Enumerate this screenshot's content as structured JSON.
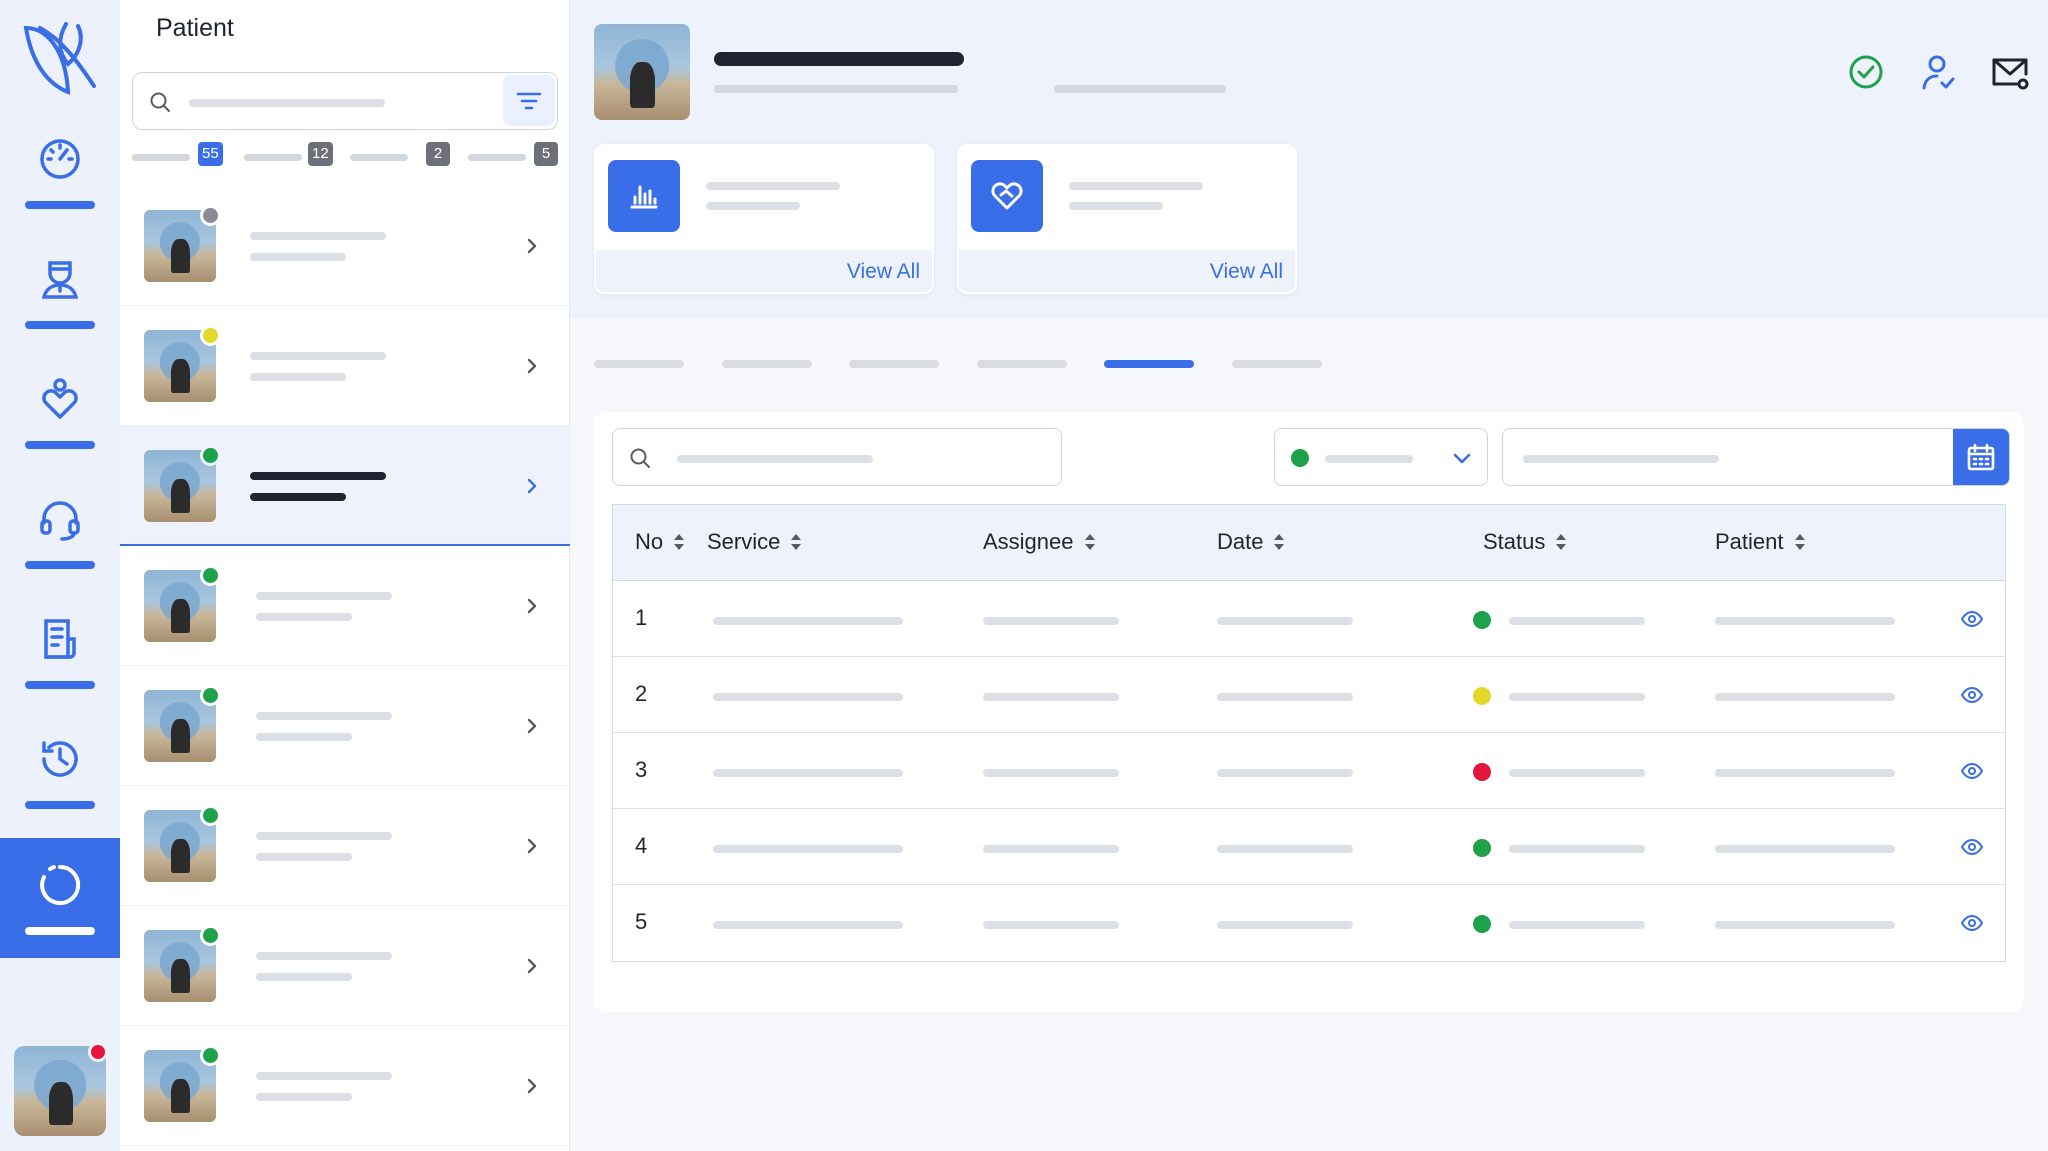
{
  "colors": {
    "accent": "#3a6ee8",
    "online": "#1ea149",
    "away": "#e3d92a",
    "busy": "#e5163b",
    "offline": "#8a8d93"
  },
  "sidebar": {
    "items": [
      {
        "icon": "dashboard-gauge-icon",
        "active": false
      },
      {
        "icon": "doctor-icon",
        "active": false
      },
      {
        "icon": "care-heart-icon",
        "active": false
      },
      {
        "icon": "headset-support-icon",
        "active": false
      },
      {
        "icon": "report-document-icon",
        "active": false
      },
      {
        "icon": "history-icon",
        "active": false
      },
      {
        "icon": "loading-spinner-icon",
        "active": true
      }
    ],
    "user_status_color": "#e5163b"
  },
  "patient_list": {
    "title": "Patient",
    "counts": [
      "55",
      "12",
      "2",
      "5"
    ],
    "patients": [
      {
        "status_color": "#8a8d93",
        "selected": false
      },
      {
        "status_color": "#e3d92a",
        "selected": false
      },
      {
        "status_color": "#1ea149",
        "selected": true
      },
      {
        "status_color": "#1ea149",
        "selected": false
      },
      {
        "status_color": "#1ea149",
        "selected": false
      },
      {
        "status_color": "#1ea149",
        "selected": false
      },
      {
        "status_color": "#1ea149",
        "selected": false
      },
      {
        "status_color": "#1ea149",
        "selected": false
      }
    ]
  },
  "header": {
    "cards": [
      {
        "icon": "analytics-bars-icon",
        "link": "View All"
      },
      {
        "icon": "heart-handshake-icon",
        "link": "View All"
      }
    ],
    "actions": [
      "verified-check-icon",
      "user-check-icon",
      "mail-settings-icon"
    ]
  },
  "tabs": {
    "count": 6,
    "active_index": 4
  },
  "table": {
    "columns": [
      "No",
      "Service",
      "Assignee",
      "Date",
      "Status",
      "Patient"
    ],
    "rows": [
      {
        "no": "1",
        "status_color": "#1ea149"
      },
      {
        "no": "2",
        "status_color": "#e3d92a"
      },
      {
        "no": "3",
        "status_color": "#e5163b"
      },
      {
        "no": "4",
        "status_color": "#1ea149"
      },
      {
        "no": "5",
        "status_color": "#1ea149"
      }
    ]
  }
}
